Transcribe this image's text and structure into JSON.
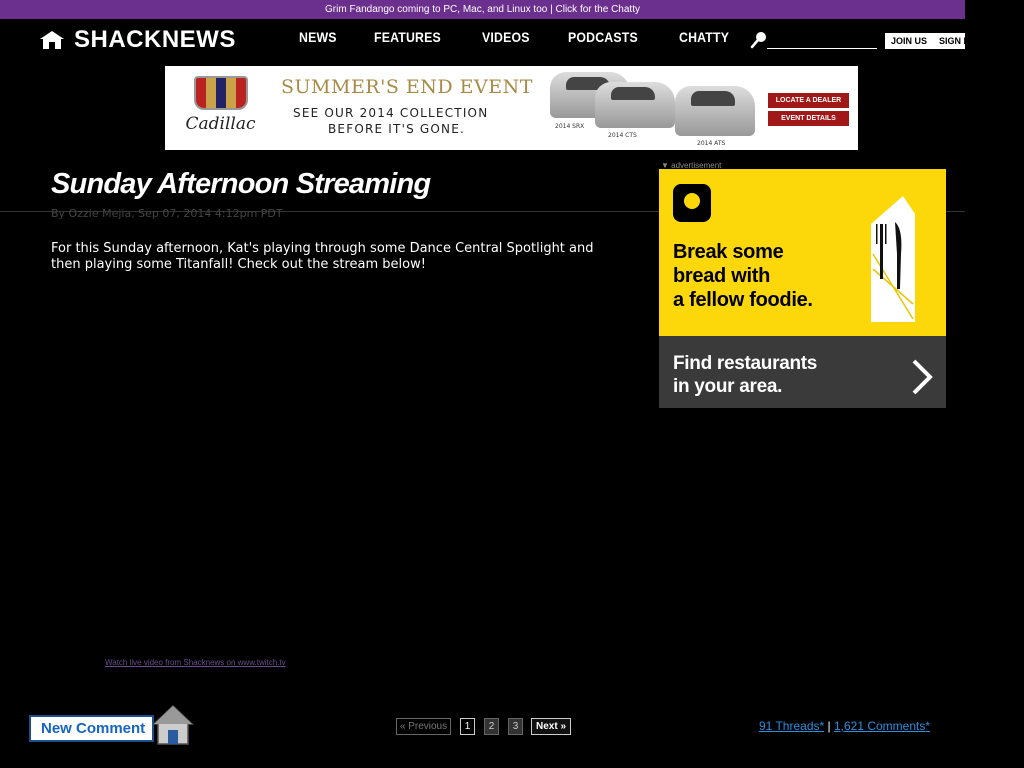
{
  "promo": {
    "headline": "Grim Fandango coming to PC, Mac, and Linux too",
    "separator": "|",
    "cta": "Click for the Chatty"
  },
  "header": {
    "logo_text": "SHACKNEWS",
    "nav": [
      "NEWS",
      "FEATURES",
      "VIDEOS",
      "PODCASTS",
      "CHATTY"
    ],
    "search_placeholder": "",
    "join_label": "JOIN US",
    "signin_label": "SIGN IN"
  },
  "banner_ad": {
    "brand": "Cadillac",
    "headline": "SUMMER'S END EVENT",
    "sub_line1": "SEE OUR 2014 COLLECTION",
    "sub_line2": "BEFORE IT'S GONE.",
    "cars": [
      "2014 SRX",
      "2014 CTS",
      "2014 ATS"
    ],
    "button1": "LOCATE A DEALER",
    "button2": "EVENT DETAILS"
  },
  "article": {
    "title": "Sunday Afternoon Streaming",
    "byline": "By Ozzie Mejia, Sep 07, 2014 4:12pm PDT",
    "body": "For this Sunday afternoon, Kat's playing through some Dance Central Spotlight and then playing some Titanfall! Check out the stream below!",
    "twitch_link": "Watch live video from Shacknews on www.twitch.tv"
  },
  "side_ad": {
    "label": "▼ advertisement",
    "headline_lines": [
      "Break some",
      "bread with",
      "a fellow foodie."
    ],
    "footer_lines": [
      "Find restaurants",
      "in your area."
    ]
  },
  "comments": {
    "new_comment_label": "New Comment",
    "pager_prev": "« Previous",
    "pages": [
      "1",
      "2",
      "3"
    ],
    "pager_next": "Next »",
    "threads_link": "91 Threads*",
    "separator": "|",
    "comments_link": "1,621 Comments*"
  },
  "colors": {
    "promo_bg": "#6b2f8e",
    "ad_yellow": "#fcd80a",
    "link_blue": "#2a8fdf"
  }
}
